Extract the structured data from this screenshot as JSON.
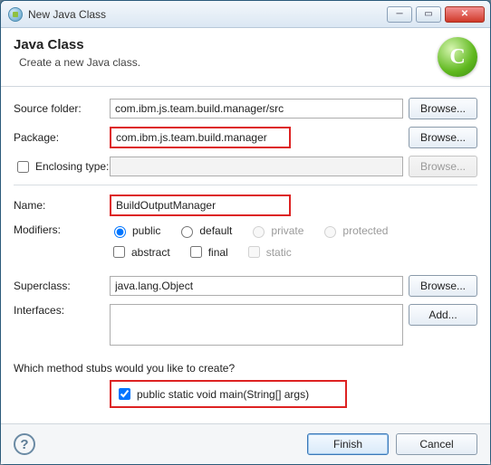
{
  "window": {
    "title": "New Java Class"
  },
  "header": {
    "title": "Java Class",
    "desc": "Create a new Java class.",
    "icon_letter": "C"
  },
  "labels": {
    "source_folder": "Source folder:",
    "package": "Package:",
    "enclosing": "Enclosing type:",
    "name": "Name:",
    "modifiers": "Modifiers:",
    "superclass": "Superclass:",
    "interfaces": "Interfaces:",
    "stub_question": "Which method stubs would you like to create?"
  },
  "buttons": {
    "browse": "Browse...",
    "add": "Add...",
    "finish": "Finish",
    "cancel": "Cancel"
  },
  "values": {
    "source_folder": "com.ibm.js.team.build.manager/src",
    "package": "com.ibm.js.team.build.manager",
    "enclosing": "",
    "name": "BuildOutputManager",
    "superclass": "java.lang.Object",
    "interfaces": ""
  },
  "modifiers": {
    "access": [
      "public",
      "default",
      "private",
      "protected"
    ],
    "access_selected": "public",
    "access_enabled": {
      "public": true,
      "default": true,
      "private": false,
      "protected": false
    },
    "flags": [
      "abstract",
      "final",
      "static"
    ],
    "flags_checked": {
      "abstract": false,
      "final": false,
      "static": false
    },
    "flags_enabled": {
      "abstract": true,
      "final": true,
      "static": false
    }
  },
  "stubs": {
    "main_label": "public static void main(String[] args)",
    "main_checked": true
  }
}
